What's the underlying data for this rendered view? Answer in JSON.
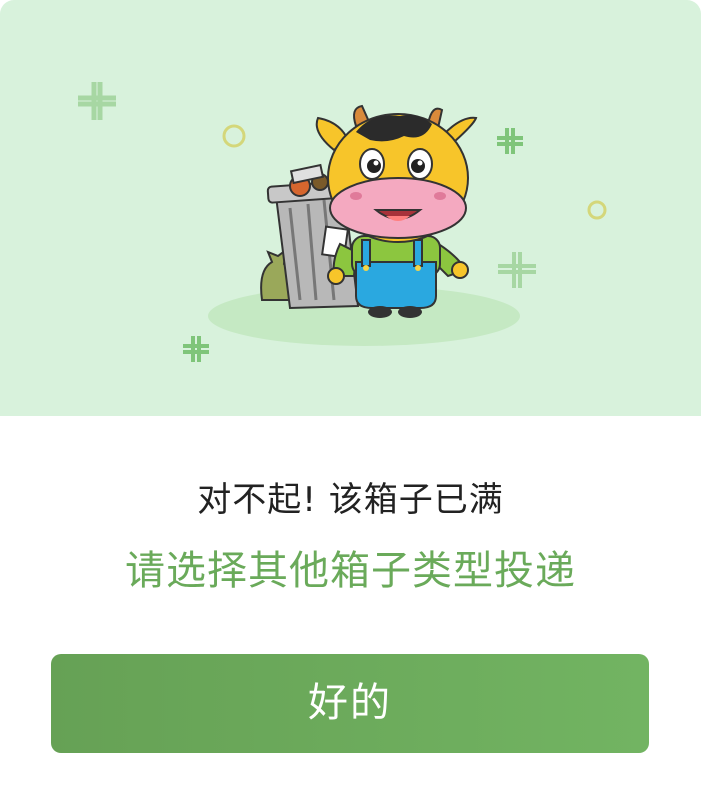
{
  "dialog": {
    "title": "对不起! 该箱子已满",
    "message": "请选择其他箱子类型投递",
    "confirm_label": "好的"
  },
  "colors": {
    "hero_background": "#d8f2dc",
    "accent_green": "#6aaa5a",
    "button_gradient_start": "#66a155",
    "button_gradient_end": "#72b462",
    "title_text": "#222222"
  },
  "illustration": {
    "subject": "cow-mascot-with-full-trash-can-icon",
    "decorations": [
      "sparkle-icon",
      "circle-icon"
    ]
  }
}
